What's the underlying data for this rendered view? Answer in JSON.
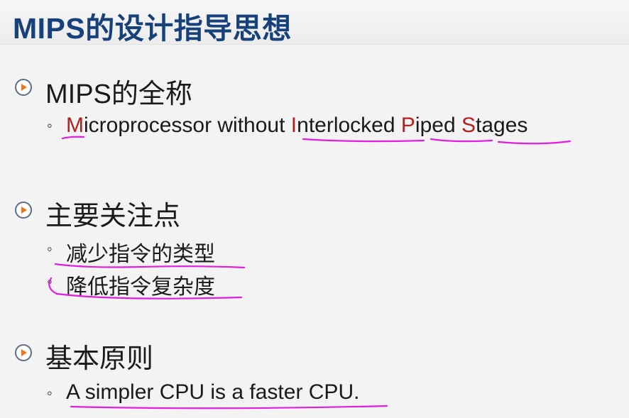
{
  "title": "MIPS的设计指导思想",
  "sections": [
    {
      "heading": "MIPS的全称",
      "items": [
        {
          "parts": [
            {
              "text": "M",
              "accent": true
            },
            {
              "text": "icroprocessor without ",
              "accent": false
            },
            {
              "text": "I",
              "accent": true
            },
            {
              "text": "nterlocked ",
              "accent": false
            },
            {
              "text": "P",
              "accent": true
            },
            {
              "text": "iped ",
              "accent": false
            },
            {
              "text": "S",
              "accent": true
            },
            {
              "text": "tages",
              "accent": false
            }
          ]
        }
      ]
    },
    {
      "heading": "主要关注点",
      "items": [
        {
          "text": "减少指令的类型"
        },
        {
          "text": "降低指令复杂度"
        }
      ]
    },
    {
      "heading": "基本原则",
      "items": [
        {
          "text": "A simpler CPU is a faster CPU."
        }
      ]
    }
  ],
  "icons": {
    "bullet": "play-circle-icon",
    "sub_bullet": "small-circle-icon"
  },
  "colors": {
    "title": "#17417a",
    "accent_letter": "#b32020",
    "annotation_ink": "#e01ee0",
    "bullet_orange": "#e8791e"
  }
}
